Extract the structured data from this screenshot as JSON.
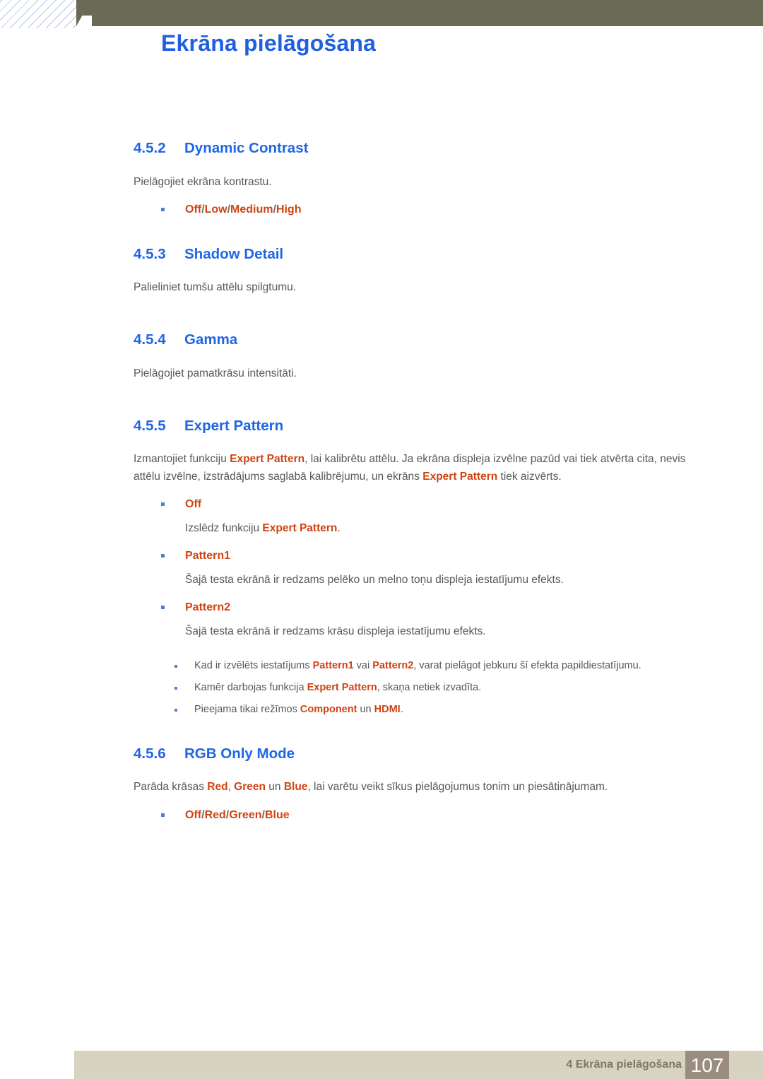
{
  "header": {
    "chapter_number": "4",
    "title": "Ekrāna pielāgošana"
  },
  "sections": [
    {
      "number": "4.5.2",
      "title": "Dynamic Contrast",
      "body": "Pielāgojiet ekrāna kontrastu.",
      "options": [
        "Off",
        "Low",
        "Medium",
        "High"
      ]
    },
    {
      "number": "4.5.3",
      "title": "Shadow Detail",
      "body": "Palieliniet tumšu attēlu spilgtumu."
    },
    {
      "number": "4.5.4",
      "title": "Gamma",
      "body": "Pielāgojiet pamatkrāsu intensitāti."
    },
    {
      "number": "4.5.5",
      "title": "Expert Pattern",
      "body_p1a": "Izmantojiet funkciju ",
      "body_kw1": "Expert Pattern",
      "body_p1b": ", lai kalibrētu attēlu. Ja ekrāna displeja izvēlne pazūd vai tiek atvērta cita, nevis attēlu izvēlne, izstrādājums saglabā kalibrējumu, un ekrāns ",
      "body_kw2": "Expert Pattern",
      "body_p1c": " tiek aizvērts.",
      "items": [
        {
          "label": "Off",
          "desc_a": "Izslēdz funkciju ",
          "desc_kw": "Expert Pattern",
          "desc_b": "."
        },
        {
          "label": "Pattern1",
          "desc_a": "Šajā testa ekrānā ir redzams pelēko un melno toņu displeja iestatījumu efekts.",
          "desc_kw": "",
          "desc_b": ""
        },
        {
          "label": "Pattern2",
          "desc_a": "Šajā testa ekrānā ir redzams krāsu displeja iestatījumu efekts.",
          "desc_kw": "",
          "desc_b": ""
        }
      ],
      "notes": [
        {
          "a": "Kad ir izvēlēts iestatījums ",
          "kw1": "Pattern1",
          "b": " vai ",
          "kw2": "Pattern2",
          "c": ", varat pielāgot jebkuru šī efekta papildiestatījumu."
        },
        {
          "a": "Kamēr darbojas funkcija ",
          "kw1": "Expert Pattern",
          "b": ", skaņa netiek izvadīta.",
          "kw2": "",
          "c": ""
        },
        {
          "a": "Pieejama tikai režīmos ",
          "kw1": "Component",
          "b": " un ",
          "kw2": "HDMI",
          "c": "."
        }
      ]
    },
    {
      "number": "4.5.6",
      "title": "RGB Only Mode",
      "body_a": "Parāda krāsas ",
      "body_kw1": "Red",
      "body_b": ", ",
      "body_kw2": "Green",
      "body_c": " un ",
      "body_kw3": "Blue",
      "body_d": ", lai varētu veikt sīkus pielāgojumus tonim un piesātinājumam.",
      "options": [
        "Off",
        "Red",
        "Green",
        "Blue"
      ]
    }
  ],
  "footer": {
    "text": "4 Ekrāna pielāgošana",
    "page_number": "107"
  },
  "colors": {
    "heading_blue": "#1f66e5",
    "title_blue": "#1f5fe0",
    "keyword_orange": "#cf4413",
    "body_gray": "#58585a",
    "banner_olive": "#6b6a55",
    "footer_beige": "#d8d3c0",
    "page_box_brown": "#9a8d80"
  }
}
